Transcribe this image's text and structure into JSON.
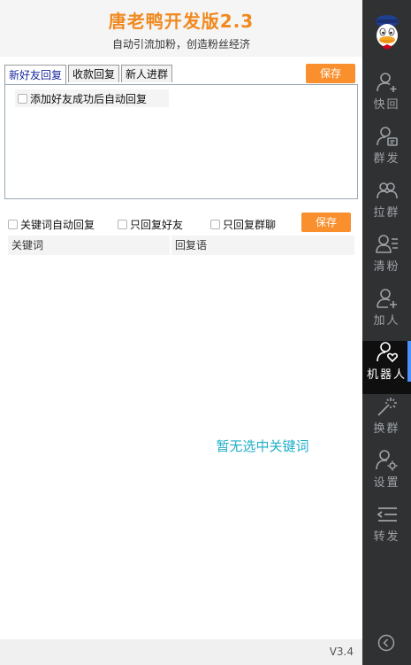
{
  "header": {
    "title": "唐老鸭开发版2.3",
    "subtitle": "自动引流加粉，创造粉丝经济"
  },
  "tabs": [
    {
      "label": "新好友回复",
      "active": true
    },
    {
      "label": "收款回复",
      "active": false
    },
    {
      "label": "新人进群",
      "active": false
    }
  ],
  "save_label": "保存",
  "friend_reply": {
    "auto_reply_label": "添加好友成功后自动回复",
    "checked": false
  },
  "keyword_options": [
    {
      "label": "关键词自动回复",
      "checked": false
    },
    {
      "label": "只回复好友",
      "checked": false
    },
    {
      "label": "只回复群聊",
      "checked": false
    }
  ],
  "keyword_table": {
    "columns": [
      "关键词",
      "回复语"
    ],
    "rows": []
  },
  "empty_message": "暂无选中关键词",
  "footer": {
    "version": "V3.4"
  },
  "sidebar": {
    "items": [
      {
        "label": "快回",
        "icon": "user-add-icon"
      },
      {
        "label": "群发",
        "icon": "user-message-icon"
      },
      {
        "label": "拉群",
        "icon": "users-group-icon"
      },
      {
        "label": "清粉",
        "icon": "user-list-icon"
      },
      {
        "label": "加人",
        "icon": "user-plus-icon"
      },
      {
        "label": "机器人",
        "icon": "user-heart-icon",
        "active": true
      },
      {
        "label": "换群",
        "icon": "magic-wand-icon"
      },
      {
        "label": "设置",
        "icon": "user-settings-icon"
      },
      {
        "label": "转发",
        "icon": "forward-list-icon"
      }
    ]
  },
  "colors": {
    "accent": "#f98f2d",
    "title": "#f0891e",
    "sidebar": "#2f3133",
    "active_bar": "#4a90ff",
    "empty_text": "#21aec8"
  }
}
